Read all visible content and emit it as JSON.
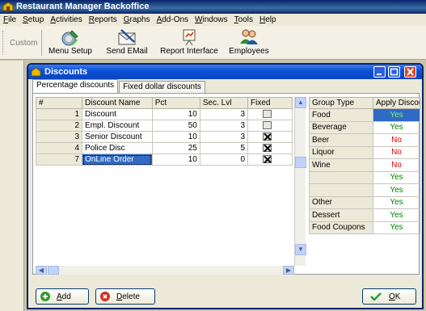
{
  "app": {
    "title": "Restaurant Manager Backoffice"
  },
  "menu": [
    "File",
    "Setup",
    "Activities",
    "Reports",
    "Graphs",
    "Add-Ons",
    "Windows",
    "Tools",
    "Help"
  ],
  "toolbar": {
    "custom_label": "Custom",
    "buttons": [
      {
        "label": "Menu Setup",
        "icon": "menu-setup-icon"
      },
      {
        "label": "Send EMail",
        "icon": "envelope-icon"
      },
      {
        "label": "Report Interface",
        "icon": "report-icon"
      },
      {
        "label": "Employees",
        "icon": "employees-icon"
      }
    ]
  },
  "dialog": {
    "title": "Discounts",
    "tabs": [
      "Percentage discounts",
      "Fixed dollar discounts"
    ],
    "active_tab": 0
  },
  "discounts": {
    "columns": [
      "#",
      "Discount Name",
      "Pct",
      "Sec. Lvl",
      "Fixed"
    ],
    "rows": [
      {
        "num": "1",
        "name": "Discount",
        "pct": "10",
        "sec": "3",
        "fixed": false
      },
      {
        "num": "2",
        "name": "Empl. Discount",
        "pct": "50",
        "sec": "3",
        "fixed": false
      },
      {
        "num": "3",
        "name": "Senior Discount",
        "pct": "10",
        "sec": "3",
        "fixed": true
      },
      {
        "num": "4",
        "name": "Police Disc",
        "pct": "25",
        "sec": "5",
        "fixed": true
      },
      {
        "num": "7",
        "name": "OnLine  Order",
        "pct": "10",
        "sec": "0",
        "fixed": true
      }
    ],
    "selected_row": 4
  },
  "groups": {
    "columns": [
      "Group Type",
      "Apply Discou"
    ],
    "rows": [
      {
        "name": "Food",
        "apply": "Yes"
      },
      {
        "name": "Beverage",
        "apply": "Yes"
      },
      {
        "name": "Beer",
        "apply": "No"
      },
      {
        "name": "Liquor",
        "apply": "No"
      },
      {
        "name": "Wine",
        "apply": "No"
      },
      {
        "name": "",
        "apply": "Yes"
      },
      {
        "name": "",
        "apply": "Yes"
      },
      {
        "name": "Other",
        "apply": "Yes"
      },
      {
        "name": "Dessert",
        "apply": "Yes"
      },
      {
        "name": "Food Coupons",
        "apply": "Yes"
      }
    ],
    "selected_row": 0
  },
  "buttons": {
    "add": "Add",
    "delete": "Delete",
    "ok": "OK"
  },
  "colors": {
    "yes": "#008000",
    "no": "#d00000",
    "selection": "#316ac5",
    "title_bar": "#0b52d6"
  }
}
